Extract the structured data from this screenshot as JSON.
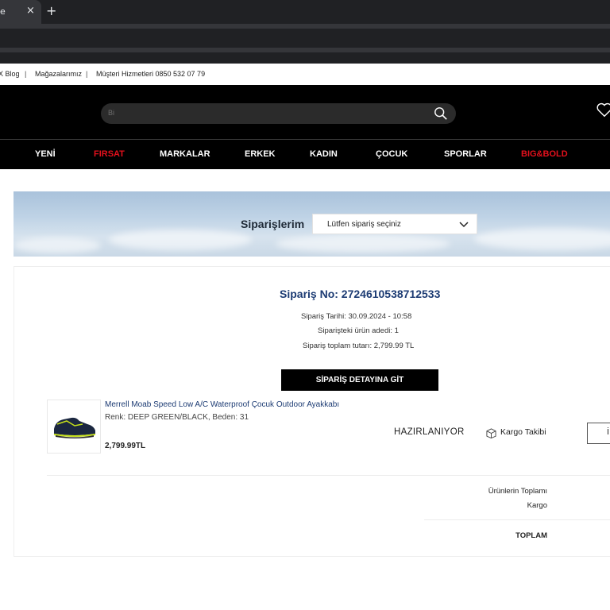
{
  "browser": {
    "tab_title": "e",
    "close_glyph": "×",
    "new_tab_glyph": "+"
  },
  "topbar": {
    "blog": "X Blog",
    "stores": "Mağazalarımız",
    "customer_service": "Müşteri Hizmetleri 0850 532 07 79",
    "separator": "|"
  },
  "header": {
    "search_placeholder": "Bi",
    "search_icon": "search-icon",
    "wishlist_icon": "heart-icon"
  },
  "nav": {
    "items": [
      {
        "label": "YENİ",
        "color": "#ffffff"
      },
      {
        "label": "FIRSAT",
        "color": "#e3101c"
      },
      {
        "label": "MARKALAR",
        "color": "#ffffff"
      },
      {
        "label": "ERKEK",
        "color": "#ffffff"
      },
      {
        "label": "KADIN",
        "color": "#ffffff"
      },
      {
        "label": "ÇOCUK",
        "color": "#ffffff"
      },
      {
        "label": "SPORLAR",
        "color": "#ffffff"
      },
      {
        "label": "BIG&BOLD",
        "color": "#e3101c"
      }
    ]
  },
  "banner": {
    "title": "Siparişlerim",
    "select_value": "Lütfen sipariş seçiniz"
  },
  "order": {
    "number": "Sipariş No: 2724610538712533",
    "date": "Sipariş Tarihi: 30.09.2024 - 10:58",
    "item_count": "Siparişteki ürün adedi: 1",
    "total_amount": "Sipariş toplam tutarı: 2,799.99 TL",
    "detail_button": "SİPARİŞ DETAYINA GİT"
  },
  "product": {
    "name": "Merrell Moab Speed Low A/C Waterproof Çocuk Outdoor Ayakkabı",
    "variant": "Renk: DEEP GREEN/BLACK, Beden: 31",
    "price": "2,799.99TL",
    "status": "HAZIRLANIYOR",
    "cargo_tracking": "Kargo Takibi",
    "edge_button_fragment": "İ"
  },
  "summary": {
    "products_total_label": "Ürünlerin Toplamı",
    "cargo_label": "Kargo",
    "total_label": "TOPLAM"
  },
  "colors": {
    "accent_red": "#e3101c",
    "link_blue": "#1c3b73",
    "header_black": "#000000"
  }
}
